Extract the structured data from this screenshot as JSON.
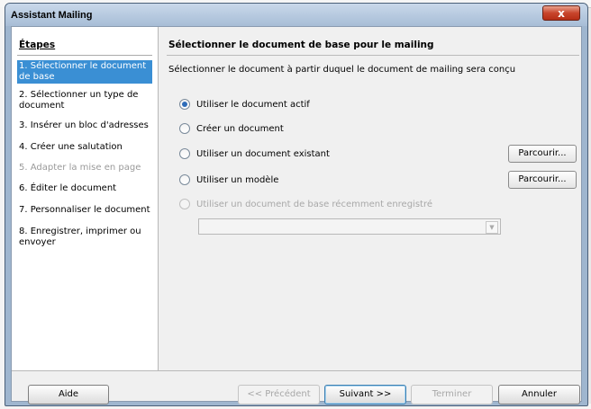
{
  "window": {
    "title": "Assistant Mailing",
    "close_glyph": "x"
  },
  "steps": {
    "title": "Étapes",
    "items": [
      {
        "label": "1. Sélectionner le document de base",
        "state": "active"
      },
      {
        "label": "2. Sélectionner un type de document",
        "state": "normal"
      },
      {
        "label": "3. Insérer un bloc d'adresses",
        "state": "normal"
      },
      {
        "label": "4. Créer une salutation",
        "state": "normal"
      },
      {
        "label": "5. Adapter la mise en page",
        "state": "disabled"
      },
      {
        "label": "6. Éditer le document",
        "state": "normal"
      },
      {
        "label": "7. Personnaliser le document",
        "state": "normal"
      },
      {
        "label": "8. Enregistrer, imprimer ou envoyer",
        "state": "normal"
      }
    ]
  },
  "main": {
    "title": "Sélectionner le document de base pour le mailing",
    "description": "Sélectionner le document à partir duquel le document de mailing sera conçu",
    "options": [
      {
        "label": "Utiliser le document actif",
        "checked": true,
        "disabled": false
      },
      {
        "label": "Créer un document",
        "checked": false,
        "disabled": false
      },
      {
        "label": "Utiliser un document existant",
        "checked": false,
        "disabled": false
      },
      {
        "label": "Utiliser un modèle",
        "checked": false,
        "disabled": false
      },
      {
        "label": "Utiliser un document de base récemment enregistré",
        "checked": false,
        "disabled": true
      }
    ],
    "browse_label": "Parcourir...",
    "recent_combo_value": ""
  },
  "footer": {
    "help": "Aide",
    "previous": "<< Précédent",
    "next": "Suivant >>",
    "finish": "Terminer",
    "cancel": "Annuler"
  },
  "colors": {
    "accent": "#3a8fd4",
    "radio_dot": "#2e6cb8"
  }
}
